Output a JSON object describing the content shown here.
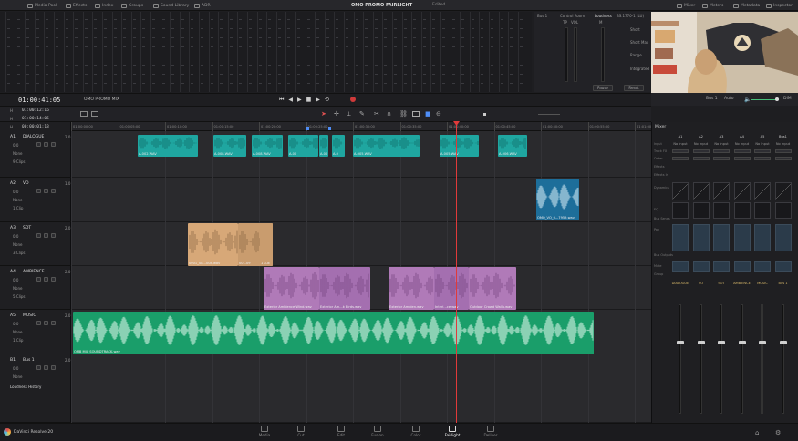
{
  "topbar": {
    "items": [
      "Media Pool",
      "Effects",
      "Index",
      "Groups",
      "Sound Library",
      "ADR"
    ],
    "title": "OMO PROMO FAIRLIGHT",
    "subtitle": "Edited",
    "right_items": [
      "Mixer",
      "Meters",
      "Metadata",
      "Inspector"
    ]
  },
  "control": {
    "bus_label": "Bus 1",
    "control_room": "Control Room",
    "tp_label": "TP",
    "vol_label": "VOL",
    "loudness": "Loudness",
    "standard": "BS.1770-1 (LU)",
    "m_label": "M",
    "labels": [
      "Short",
      "Short Max",
      "Range",
      "Integrated"
    ],
    "pause": "Pause",
    "reset": "Reset"
  },
  "timecode": {
    "main": "01:00:41:05",
    "timeline_name": "OMO PROMO MIX",
    "in": "01:00:12:16",
    "out": "01:00:14:05",
    "duration": "00:00:01:13"
  },
  "viewer": {
    "bus": "Bus 1",
    "auto": "Auto",
    "level": "DIM"
  },
  "ruler": [
    "01:00:00:00",
    "01:00:05:00",
    "01:00:10:00",
    "01:00:15:00",
    "01:00:20:00",
    "01:00:25:00",
    "01:00:30:00",
    "01:00:35:00",
    "01:00:40:00",
    "01:00:45:00",
    "01:00:50:00",
    "01:00:55:00",
    "01:01:00:00"
  ],
  "tracks": [
    {
      "id": "A1",
      "name": "DIALOGUE",
      "ch": "2.0",
      "vol": "0.0",
      "mode": "None",
      "clips": "9 Clips"
    },
    {
      "id": "A2",
      "name": "VO",
      "ch": "1.0",
      "vol": "0.0",
      "mode": "None",
      "clips": "1 Clip"
    },
    {
      "id": "A3",
      "name": "SOT",
      "ch": "2.0",
      "vol": "0.0",
      "mode": "None",
      "clips": "3 Clips"
    },
    {
      "id": "A4",
      "name": "AMBIENCE",
      "ch": "2.0",
      "vol": "0.0",
      "mode": "None",
      "clips": "5 Clips"
    },
    {
      "id": "A5",
      "name": "MUSIC",
      "ch": "2.0",
      "vol": "0.0",
      "mode": "None",
      "clips": "1 Clip"
    },
    {
      "id": "B1",
      "name": "Bus 1",
      "ch": "2.0",
      "vol": "0.0",
      "mode": "None",
      "clips": ""
    }
  ],
  "loudness_history": "Loudness History",
  "clip_labels": {
    "dialogue": [
      "A-002.WAV",
      "A-008.WAV",
      "A-008.WAV",
      "A-00",
      "A-00",
      "A-0",
      "A-005.WAV",
      "A-005.WAV",
      "A-006.WAV"
    ],
    "vo": "OMO_VO_0...7959.wav",
    "sot": [
      "0001_08...008.wav",
      "00...09",
      "1 Lux"
    ],
    "ambience": [
      "Exterior Ambience Wind.wav",
      "Exterior Am...k Birds.wav",
      "Exterior Ambien.wav",
      "Interi...ce.wav",
      "Outdoor Crowd Walla.wav"
    ],
    "music": "OMB MIX SOUNDTRACK.wav"
  },
  "mixer": {
    "title": "Mixer",
    "channels": [
      "A1",
      "A2",
      "A3",
      "A4",
      "A5",
      "Bus1"
    ],
    "names": [
      "DIALOGUE",
      "VO",
      "SOT",
      "AMBIENCE",
      "MUSIC",
      "Bus 1"
    ],
    "rows": [
      "Input",
      "Track FX",
      "Order",
      "Effects",
      "Effects In",
      "Dynamics",
      "EQ",
      "Bus Sends",
      "Pan",
      "Bus Outputs",
      "Mute",
      "Group"
    ],
    "input_val": "No Input"
  },
  "pages": [
    "Media",
    "Cut",
    "Edit",
    "Fusion",
    "Color",
    "Fairlight",
    "Deliver"
  ],
  "active_page": "Fairlight",
  "brand": "DaVinci Resolve 20",
  "colors": {
    "dialogue": "#1fa6a0",
    "vo": "#1d6e9a",
    "sot": "#d7a878",
    "ambience": "#b07ab8",
    "music": "#1a9e6a",
    "playhead": "#e03a3a"
  }
}
